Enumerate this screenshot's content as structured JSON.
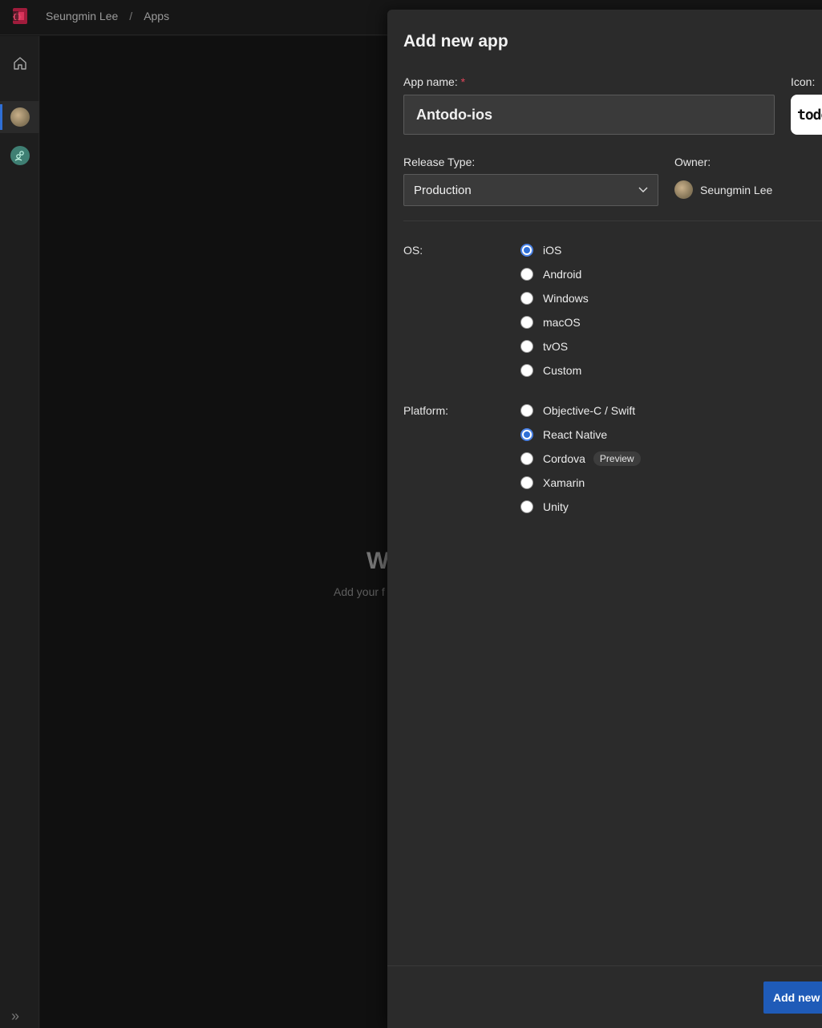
{
  "breadcrumb": {
    "user": "Seungmin Lee",
    "separator": "/",
    "section": "Apps"
  },
  "background": {
    "welcome_title": "W",
    "welcome_subtitle": "Add your f"
  },
  "panel": {
    "title": "Add new app",
    "app_name_label": "App name:",
    "required_mark": "*",
    "app_name_value": "Antodo-ios",
    "icon_label": "Icon:",
    "icon_text": "todo",
    "release_type_label": "Release Type:",
    "release_type_value": "Production",
    "owner_label": "Owner:",
    "owner_name": "Seungmin Lee",
    "os_label": "OS:",
    "os_options": [
      {
        "label": "iOS",
        "checked": true
      },
      {
        "label": "Android",
        "checked": false
      },
      {
        "label": "Windows",
        "checked": false
      },
      {
        "label": "macOS",
        "checked": false
      },
      {
        "label": "tvOS",
        "checked": false
      },
      {
        "label": "Custom",
        "checked": false
      }
    ],
    "platform_label": "Platform:",
    "platform_options": [
      {
        "label": "Objective-C / Swift",
        "checked": false
      },
      {
        "label": "React Native",
        "checked": true
      },
      {
        "label": "Cordova",
        "checked": false,
        "badge": "Preview"
      },
      {
        "label": "Xamarin",
        "checked": false
      },
      {
        "label": "Unity",
        "checked": false
      }
    ],
    "submit_label": "Add new"
  },
  "colors": {
    "accent": "#2f6fd6",
    "required": "#e0455a",
    "brand": "#c8234a"
  }
}
